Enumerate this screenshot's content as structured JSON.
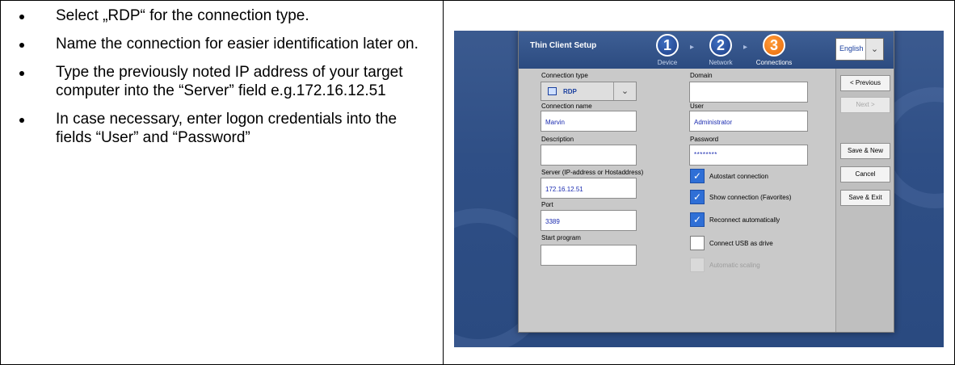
{
  "instructions": [
    "Select „RDP“ for the connection type.",
    "Name the connection for easier identification later on.",
    "Type the previously noted IP address of your target computer into the “Server” field e.g.172.16.12.51",
    "In case necessary, enter logon credentials into the fields “User” and “Password”"
  ],
  "dialog": {
    "title": "Thin Client Setup",
    "steps": [
      {
        "number": "1",
        "label": "Device"
      },
      {
        "number": "2",
        "label": "Network"
      },
      {
        "number": "3",
        "label": "Connections"
      }
    ],
    "active_step": 3,
    "language": "English",
    "fields": {
      "connection_type_label": "Connection type",
      "connection_type_value": "RDP",
      "connection_name_label": "Connection name",
      "connection_name_value": "Marvin",
      "description_label": "Description",
      "description_value": "",
      "server_label": "Server (IP-address or Hostaddress)",
      "server_value": "172.16.12.51",
      "port_label": "Port",
      "port_value": "3389",
      "start_program_label": "Start program",
      "start_program_value": "",
      "domain_label": "Domain",
      "domain_value": "",
      "user_label": "User",
      "user_value": "Administrator",
      "password_label": "Password",
      "password_value": "********"
    },
    "checkboxes": [
      {
        "label": "Autostart connection",
        "checked": true,
        "disabled": false
      },
      {
        "label": "Show connection (Favorites)",
        "checked": true,
        "disabled": false
      },
      {
        "label": "Reconnect automatically",
        "checked": true,
        "disabled": false
      },
      {
        "label": "Connect USB as drive",
        "checked": false,
        "disabled": false
      },
      {
        "label": "Automatic scaling",
        "checked": false,
        "disabled": true
      }
    ],
    "buttons": {
      "previous": "< Previous",
      "next": "Next >",
      "save_new": "Save & New",
      "cancel": "Cancel",
      "save_exit": "Save & Exit"
    }
  },
  "colors": {
    "background_blue": "#2f4f86",
    "active_step_orange": "#f07a14",
    "step_blue": "#2a54a8",
    "checkbox_blue": "#2f6fd6",
    "field_text": "#1a2bb0"
  }
}
